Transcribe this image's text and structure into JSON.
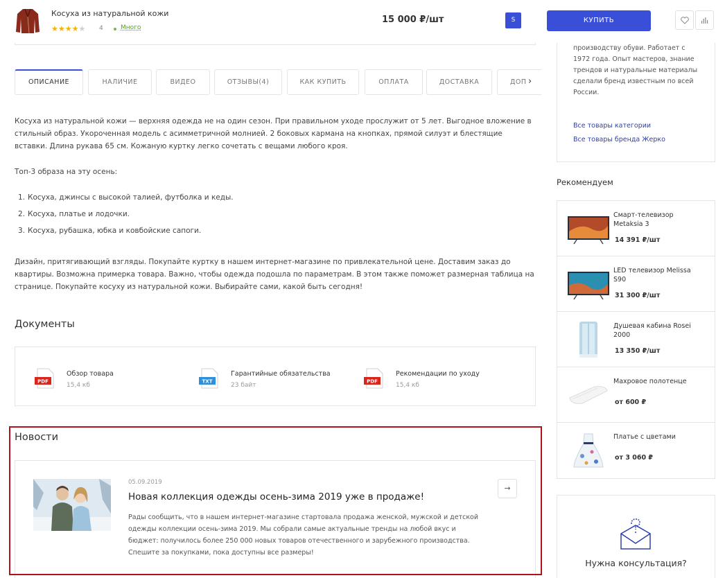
{
  "header": {
    "product_title": "Косуха из натуральной кожи",
    "rating_value": 4,
    "rating_count": "4",
    "stock_label": "Много",
    "price": "15 000 ₽/шт",
    "size": "S",
    "buy_label": "КУПИТЬ",
    "colors": {
      "accent": "#3a4fd8",
      "star": "#f5b301",
      "stock": "#5a9e2f"
    }
  },
  "tabs": [
    {
      "label": "ОПИСАНИЕ",
      "active": true
    },
    {
      "label": "НАЛИЧИЕ"
    },
    {
      "label": "ВИДЕО"
    },
    {
      "label": "ОТЗЫВЫ(4)"
    },
    {
      "label": "КАК КУПИТЬ"
    },
    {
      "label": "ОПЛАТА"
    },
    {
      "label": "ДОСТАВКА"
    },
    {
      "label": "ДОП"
    }
  ],
  "description": {
    "p1": "Косуха из натуральной кожи — верхняя одежда не на один сезон. При правильном уходе прослужит от 5 лет. Выгодное вложение в стильный образ. Укороченная модель с асимметричной молнией. 2 боковых кармана на кнопках, прямой силуэт и блестящие вставки. Длина рукава 65 см. Кожаную куртку легко сочетать с вещами любого кроя.",
    "p2": "Топ-3 образа на эту осень:",
    "list": [
      {
        "num": "1.",
        "text": "Косуха, джинсы с высокой талией, футболка и кеды."
      },
      {
        "num": "2.",
        "text": "Косуха, платье и лодочки."
      },
      {
        "num": "3.",
        "text": "Косуха, рубашка, юбка и ковбойские сапоги."
      }
    ],
    "p3": "Дизайн, притягивающий взгляды. Покупайте куртку в нашем интернет-магазине по привлекательной цене. Доставим заказ до квартиры. Возможна примерка товара. Важно, чтобы одежда подошла по параметрам. В этом также поможет размерная таблица на странице. Покупайте косуху из натуральной кожи. Выбирайте сами, какой быть сегодня!"
  },
  "documents": {
    "title": "Документы",
    "items": [
      {
        "type": "PDF",
        "name": "Обзор товара",
        "size": "15,4 кб",
        "color": "#d9261c"
      },
      {
        "type": "TXT",
        "name": "Гарантийные обязательства",
        "size": "23 байт",
        "color": "#2f8fd8"
      },
      {
        "type": "PDF",
        "name": "Рекомендации по уходу",
        "size": "15,4 кб",
        "color": "#d9261c"
      }
    ]
  },
  "news": {
    "title": "Новости",
    "date": "05.09.2019",
    "headline": "Новая коллекция одежды осень-зима 2019 уже в продаже!",
    "text": "Рады сообщить, что в нашем интернет-магазине стартовала продажа женской, мужской и детской одежды коллекции осень-зима 2019. Мы собрали самые актуальные тренды на любой вкус и бюджет: получилось более 250 000 новых товаров отечественного и зарубежного производства. Спешите за покупками, пока доступны все размеры!"
  },
  "sidebar": {
    "brand_text": "производству обуви. Работает с 1972 года. Опыт мастеров, знание трендов и натуральные материалы сделали бренд известным по всей России.",
    "link_category": "Все товары категории",
    "link_brand": "Все товары бренда Жерко",
    "recommend_title": "Рекомендуем",
    "recommended": [
      {
        "name": "Смарт-телевизор Metaksia 3",
        "price": "14 391 ₽/шт",
        "icon": "tv"
      },
      {
        "name": "LED телевизор Melissa S90",
        "price": "31 300 ₽/шт",
        "icon": "tv"
      },
      {
        "name": "Душевая кабина Rosei 2000",
        "price": "13 350 ₽/шт",
        "icon": "shower"
      },
      {
        "name": "Махровое полотенце",
        "price": "от 600 ₽",
        "icon": "towel"
      },
      {
        "name": "Платье с цветами",
        "price": "от 3 060 ₽",
        "icon": "dress"
      }
    ],
    "consult_title": "Нужна консультация?"
  }
}
